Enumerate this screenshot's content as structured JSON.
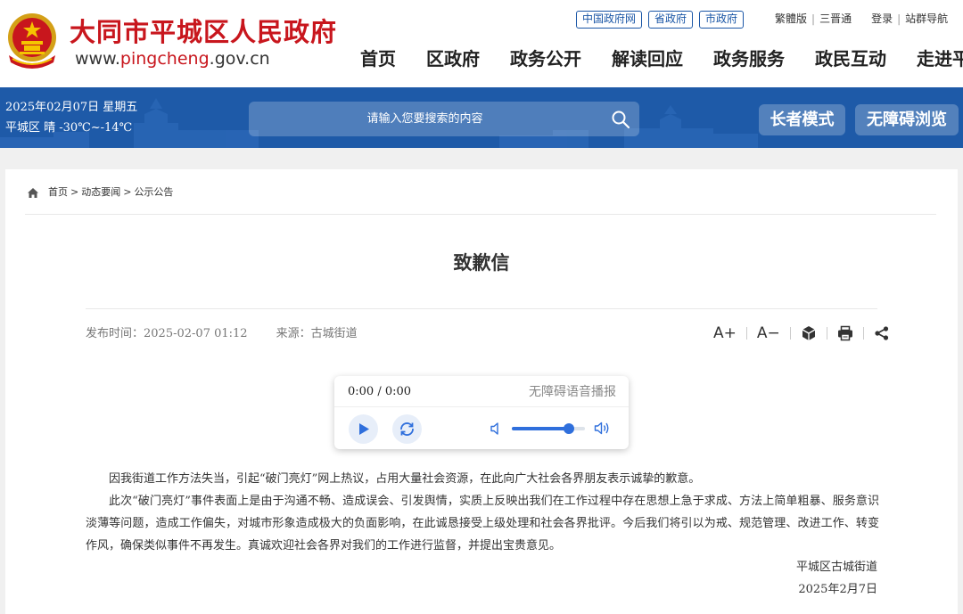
{
  "header": {
    "site_title": "大同市平城区人民政府",
    "site_url_prefix": "www.",
    "site_url_accent": "pingcheng",
    "site_url_suffix": ".gov.cn",
    "top_links": [
      "中国政府网",
      "省政府",
      "市政府"
    ],
    "util_links": {
      "traditional": "繁體版",
      "sanjin": "三晋通",
      "login": "登录",
      "site_nav": "站群导航"
    },
    "nav": [
      "首页",
      "区政府",
      "政务公开",
      "解读回应",
      "政务服务",
      "政民互动",
      "走进平城"
    ]
  },
  "band": {
    "date": "2025年02月07日 星期五",
    "weather": "平城区 晴 -30℃~-14℃",
    "search_placeholder": "请输入您要搜索的内容",
    "elder_mode": "长者模式",
    "accessible_browse": "无障碍浏览"
  },
  "breadcrumb": {
    "home": "首页",
    "sep": ">",
    "section": "动态要闻",
    "current": "公示公告"
  },
  "article": {
    "title": "致歉信",
    "publish_label": "发布时间：",
    "publish_time": "2025-02-07 01:12",
    "source_label": "来源：",
    "source": "古城街道",
    "paragraphs": [
      "因我街道工作方法失当，引起“破门亮灯”网上热议，占用大量社会资源，在此向广大社会各界朋友表示诚挚的歉意。",
      "此次“破门亮灯”事件表面上是由于沟通不畅、造成误会、引发舆情，实质上反映出我们在工作过程中存在思想上急于求成、方法上简单粗暴、服务意识淡薄等问题，造成工作偏失，对城市形象造成极大的负面影响，在此诚恳接受上级处理和社会各界批评。今后我们将引以为戒、规范管理、改进工作、转变作风，确保类似事件不再发生。真诚欢迎社会各界对我们的工作进行监督，并提出宝贵意见。"
    ],
    "signature_org": "平城区古城街道",
    "signature_date": "2025年2月7日"
  },
  "tools": {
    "font_increase": "A+",
    "font_decrease": "A−"
  },
  "player": {
    "time": "0:00 / 0:00",
    "label": "无障碍语音播报",
    "volume": 0.78
  },
  "colors": {
    "brand_red": "#c8161d",
    "band_blue": "#1e5aa8",
    "player_blue": "#2f6fdc"
  }
}
